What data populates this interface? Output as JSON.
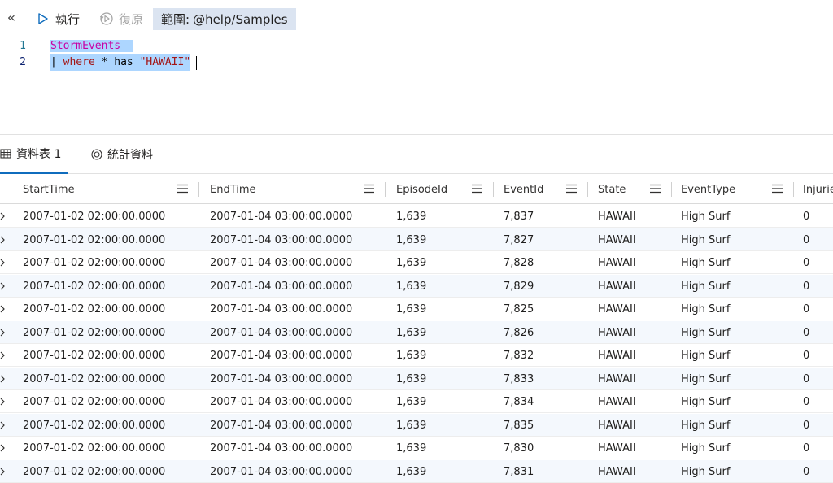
{
  "toolbar": {
    "run_label": "執行",
    "restore_label": "復原",
    "scope_label": "範圍:",
    "scope_value": "@help/Samples"
  },
  "editor": {
    "lines": [
      {
        "number": "1",
        "text": "StormEvents"
      },
      {
        "number": "2",
        "pipe": "|",
        "keyword": "where",
        "op": "*",
        "fn": "has",
        "str": "\"HAWAII\""
      }
    ]
  },
  "tabs": [
    {
      "label": "資料表 1",
      "icon": "table-icon"
    },
    {
      "label": "統計資料",
      "icon": "stats-icon"
    }
  ],
  "grid": {
    "columns": [
      "StartTime",
      "EndTime",
      "EpisodeId",
      "EventId",
      "State",
      "EventType",
      "Injurie"
    ],
    "rows": [
      [
        "2007-01-02 02:00:00.0000",
        "2007-01-04 03:00:00.0000",
        "1,639",
        "7,837",
        "HAWAII",
        "High Surf",
        "0"
      ],
      [
        "2007-01-02 02:00:00.0000",
        "2007-01-04 03:00:00.0000",
        "1,639",
        "7,827",
        "HAWAII",
        "High Surf",
        "0"
      ],
      [
        "2007-01-02 02:00:00.0000",
        "2007-01-04 03:00:00.0000",
        "1,639",
        "7,828",
        "HAWAII",
        "High Surf",
        "0"
      ],
      [
        "2007-01-02 02:00:00.0000",
        "2007-01-04 03:00:00.0000",
        "1,639",
        "7,829",
        "HAWAII",
        "High Surf",
        "0"
      ],
      [
        "2007-01-02 02:00:00.0000",
        "2007-01-04 03:00:00.0000",
        "1,639",
        "7,825",
        "HAWAII",
        "High Surf",
        "0"
      ],
      [
        "2007-01-02 02:00:00.0000",
        "2007-01-04 03:00:00.0000",
        "1,639",
        "7,826",
        "HAWAII",
        "High Surf",
        "0"
      ],
      [
        "2007-01-02 02:00:00.0000",
        "2007-01-04 03:00:00.0000",
        "1,639",
        "7,832",
        "HAWAII",
        "High Surf",
        "0"
      ],
      [
        "2007-01-02 02:00:00.0000",
        "2007-01-04 03:00:00.0000",
        "1,639",
        "7,833",
        "HAWAII",
        "High Surf",
        "0"
      ],
      [
        "2007-01-02 02:00:00.0000",
        "2007-01-04 03:00:00.0000",
        "1,639",
        "7,834",
        "HAWAII",
        "High Surf",
        "0"
      ],
      [
        "2007-01-02 02:00:00.0000",
        "2007-01-04 03:00:00.0000",
        "1,639",
        "7,835",
        "HAWAII",
        "High Surf",
        "0"
      ],
      [
        "2007-01-02 02:00:00.0000",
        "2007-01-04 03:00:00.0000",
        "1,639",
        "7,830",
        "HAWAII",
        "High Surf",
        "0"
      ],
      [
        "2007-01-02 02:00:00.0000",
        "2007-01-04 03:00:00.0000",
        "1,639",
        "7,831",
        "HAWAII",
        "High Surf",
        "0"
      ]
    ]
  },
  "colors": {
    "accent": "#0f6cbd",
    "selection": "#add6ff",
    "scope_bg": "#dbe4f1",
    "alt_row": "#f4f8fd"
  }
}
